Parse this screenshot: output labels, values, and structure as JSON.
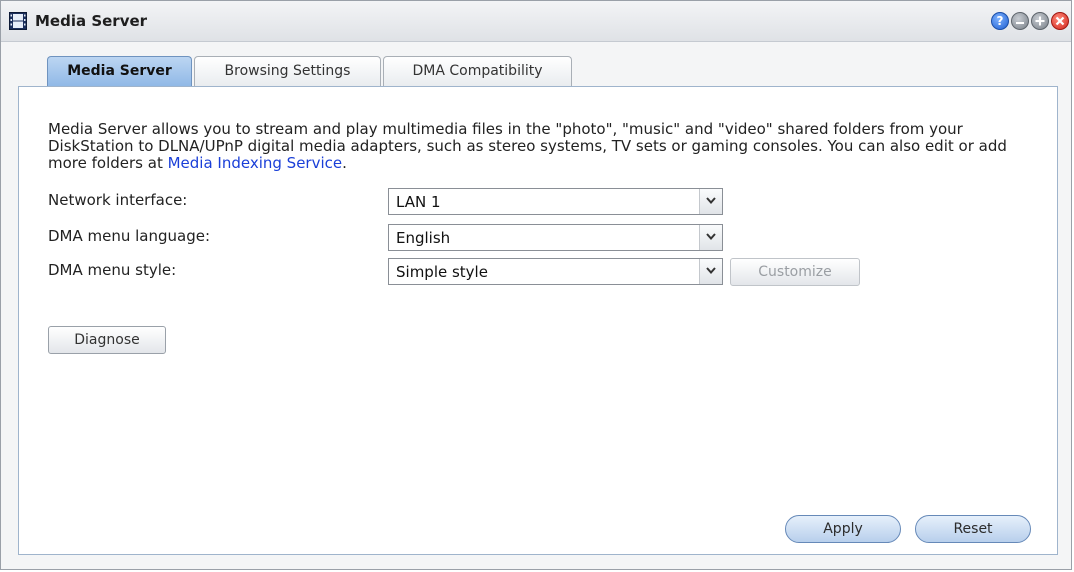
{
  "window": {
    "title": "Media Server"
  },
  "tabs": [
    {
      "label": "Media Server",
      "active": true
    },
    {
      "label": "Browsing Settings",
      "active": false
    },
    {
      "label": "DMA Compatibility",
      "active": false
    }
  ],
  "description": {
    "text": "Media Server allows you to stream and play multimedia files in the \"photo\", \"music\" and \"video\" shared folders from your DiskStation to DLNA/UPnP digital media adapters, such as stereo systems, TV sets or gaming consoles. You can also edit or add more folders at ",
    "link": "Media Indexing Service",
    "suffix": "."
  },
  "fields": {
    "network_interface": {
      "label": "Network interface:",
      "value": "LAN 1"
    },
    "dma_menu_language": {
      "label": "DMA menu language:",
      "value": "English"
    },
    "dma_menu_style": {
      "label": "DMA menu style:",
      "value": "Simple style"
    }
  },
  "buttons": {
    "customize": "Customize",
    "diagnose": "Diagnose",
    "apply": "Apply",
    "reset": "Reset"
  },
  "icons": {
    "app": "film-strip-icon",
    "help": "help-icon",
    "minimize": "minimize-icon",
    "maximize": "maximize-icon",
    "close": "close-icon",
    "dropdown": "chevron-down-icon"
  },
  "colors": {
    "link": "#1a3fd8",
    "active_tab": "#8fb8e6",
    "close_button": "#d0241b",
    "help_button": "#1f5fd1"
  }
}
